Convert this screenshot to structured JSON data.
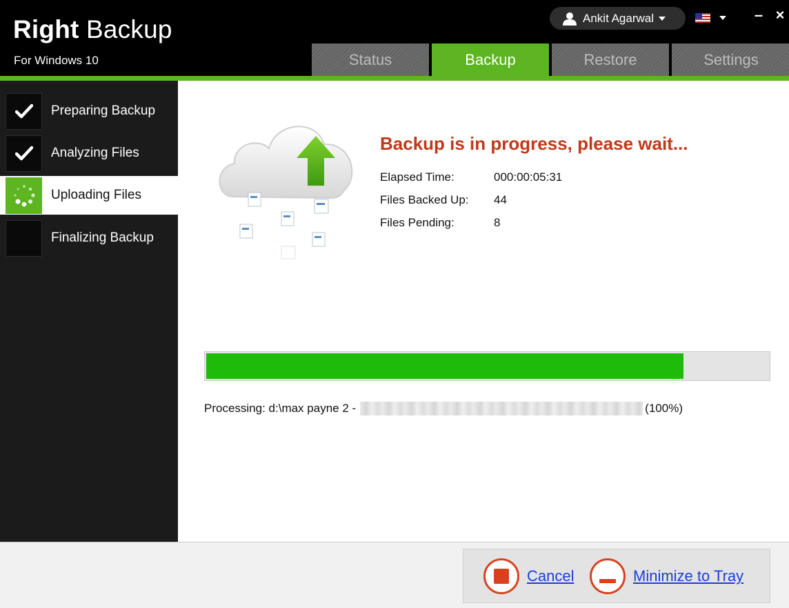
{
  "app": {
    "title_bold": "Right",
    "title_light": "Backup",
    "subtitle": "For Windows 10"
  },
  "header": {
    "user_name": "Ankit Agarwal",
    "window_controls": {
      "minimize": "–",
      "close": "×"
    }
  },
  "tabs": [
    {
      "label": "Status",
      "active": false
    },
    {
      "label": "Backup",
      "active": true
    },
    {
      "label": "Restore",
      "active": false
    },
    {
      "label": "Settings",
      "active": false
    }
  ],
  "steps": [
    {
      "label": "Preparing Backup",
      "state": "done",
      "icon": "checkmark-icon"
    },
    {
      "label": "Analyzing Files",
      "state": "done",
      "icon": "checkmark-icon"
    },
    {
      "label": "Uploading Files",
      "state": "current",
      "icon": "spinner-icon"
    },
    {
      "label": "Finalizing Backup",
      "state": "pending",
      "icon": ""
    }
  ],
  "status": {
    "title": "Backup is in progress, please wait...",
    "rows": [
      {
        "key": "Elapsed Time:",
        "value": "000:00:05:31"
      },
      {
        "key": "Files Backed Up:",
        "value": "44"
      },
      {
        "key": "Files Pending:",
        "value": "8"
      }
    ]
  },
  "progress": {
    "fraction": 0.85
  },
  "processing": {
    "prefix": "Processing: d:\\max payne 2 -",
    "suffix": "(100%)"
  },
  "footer": {
    "cancel_label": "Cancel",
    "minimize_label": "Minimize to Tray"
  },
  "colors": {
    "accent_green": "#5cb521",
    "progress_green": "#1fbb0b",
    "status_red": "#c0391a",
    "link_blue": "#1a3fd6"
  }
}
